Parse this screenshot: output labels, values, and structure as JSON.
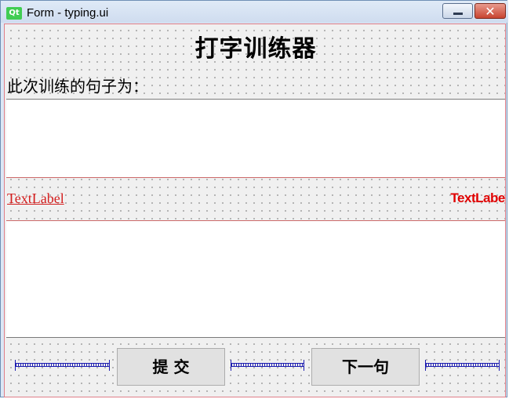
{
  "window": {
    "icon_text": "Qt",
    "title": "Form - typing.ui",
    "close_symbol": "✕"
  },
  "form": {
    "title": "打字训练器",
    "prompt_label": "此次训练的句子为：",
    "left_label": "TextLabel",
    "right_label": "TextLabel",
    "submit_label": "提  交",
    "next_label": "下一句"
  },
  "colors": {
    "label_red": "#d41c1c",
    "qt_green": "#41cd52",
    "spacer_blue": "#1b1bb0"
  }
}
